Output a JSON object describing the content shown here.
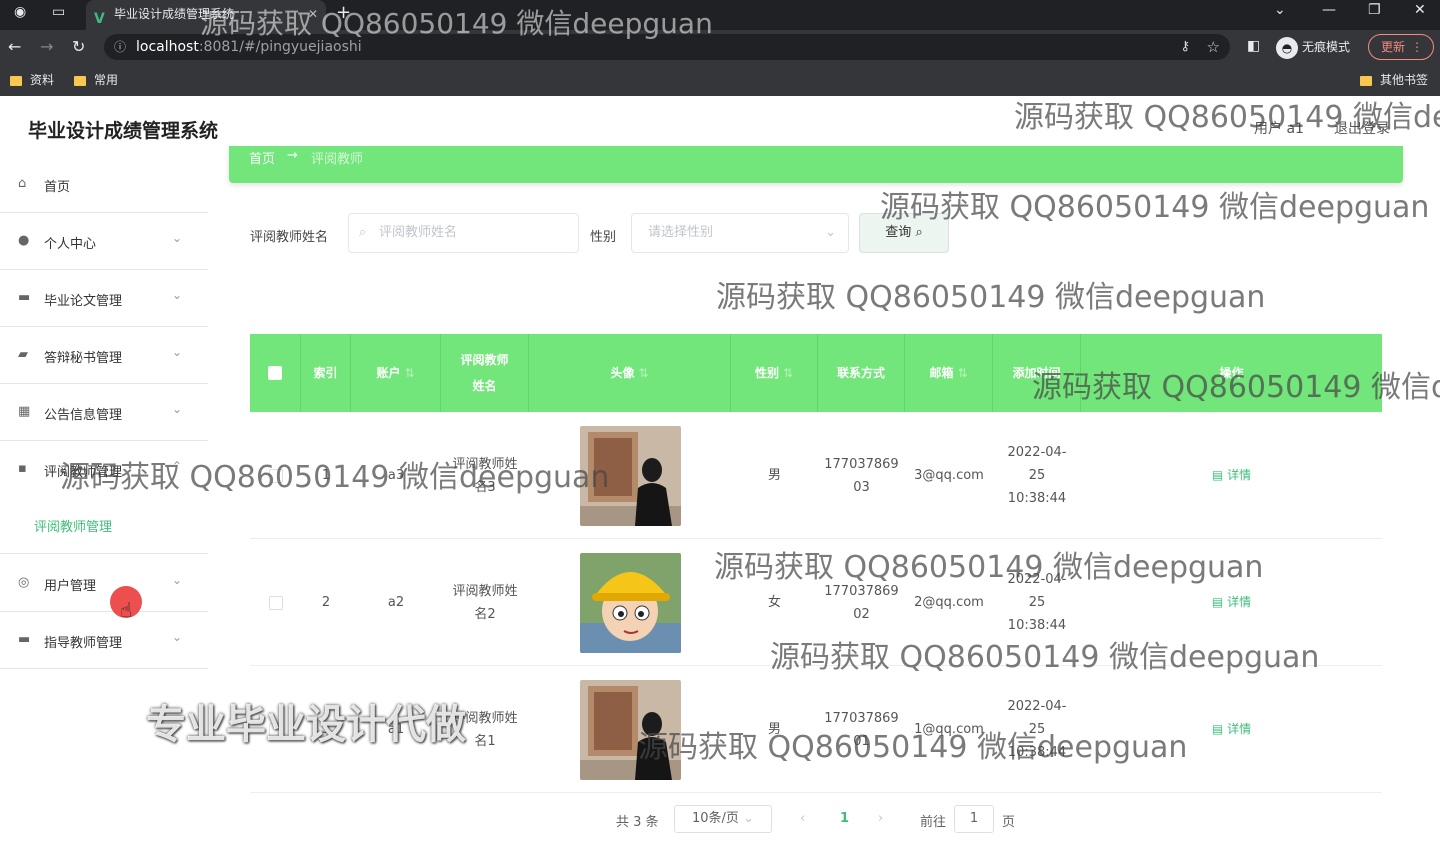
{
  "browser": {
    "tab_title": "毕业设计成绩管理系统",
    "tab_favicon": "V",
    "url_host": "localhost",
    "url_path": ":8081/#/pingyuejiaoshi",
    "profile_label": "无痕模式",
    "update_label": "更新",
    "bookmarks": [
      "资料",
      "常用"
    ],
    "other_bookmarks": "其他书签"
  },
  "app": {
    "title": "毕业设计成绩管理系统",
    "user_label": "用户 a1",
    "logout_label": "退出登录"
  },
  "sidebar": {
    "items": [
      {
        "label": "首页",
        "icon": "home-icon"
      },
      {
        "label": "个人中心",
        "icon": "user-icon"
      },
      {
        "label": "毕业论文管理",
        "icon": "monitor-icon"
      },
      {
        "label": "答辩秘书管理",
        "icon": "briefcase-icon"
      },
      {
        "label": "公告信息管理",
        "icon": "grid-icon"
      },
      {
        "label": "评阅教师管理",
        "icon": "chat-icon"
      },
      {
        "label": "用户管理",
        "icon": "compass-icon"
      },
      {
        "label": "指导教师管理",
        "icon": "id-card-icon"
      }
    ],
    "active_sub": "评阅教师管理"
  },
  "breadcrumb": {
    "home": "首页",
    "arrow": "→",
    "current": "评阅教师"
  },
  "search": {
    "name_label": "评阅教师姓名",
    "name_placeholder": "评阅教师姓名",
    "gender_label": "性别",
    "gender_placeholder": "请选择性别",
    "query_label": "查询"
  },
  "table": {
    "headers": [
      "索引",
      "账户",
      "评阅教师姓名",
      "头像",
      "性别",
      "联系方式",
      "邮箱",
      "添加时间",
      "操作"
    ],
    "rows": [
      {
        "index": "1",
        "account": "a3",
        "name": "评阅教师姓名3",
        "gender": "男",
        "phone": "17703786903",
        "email": "3@qq.com",
        "time": "2022-04-25 10:38:44",
        "action": "详情"
      },
      {
        "index": "2",
        "account": "a2",
        "name": "评阅教师姓名2",
        "gender": "女",
        "phone": "17703786902",
        "email": "2@qq.com",
        "time": "2022-04-25 10:38:44",
        "action": "详情"
      },
      {
        "index": "3",
        "account": "a1",
        "name": "评阅教师姓名1",
        "gender": "男",
        "phone": "17703786901",
        "email": "1@qq.com",
        "time": "2022-04-25 10:38:44",
        "action": "详情"
      }
    ]
  },
  "pagination": {
    "total": "共 3 条",
    "page_size": "10条/页",
    "current_page": "1",
    "goto_label": "前往",
    "goto_value": "1",
    "page_unit": "页"
  },
  "watermark": {
    "text": "源码获取 QQ86050149 微信deepguan",
    "big_text": "专业毕业设计代做"
  },
  "colors": {
    "accent": "#72e67a",
    "link": "#3bbf79"
  }
}
